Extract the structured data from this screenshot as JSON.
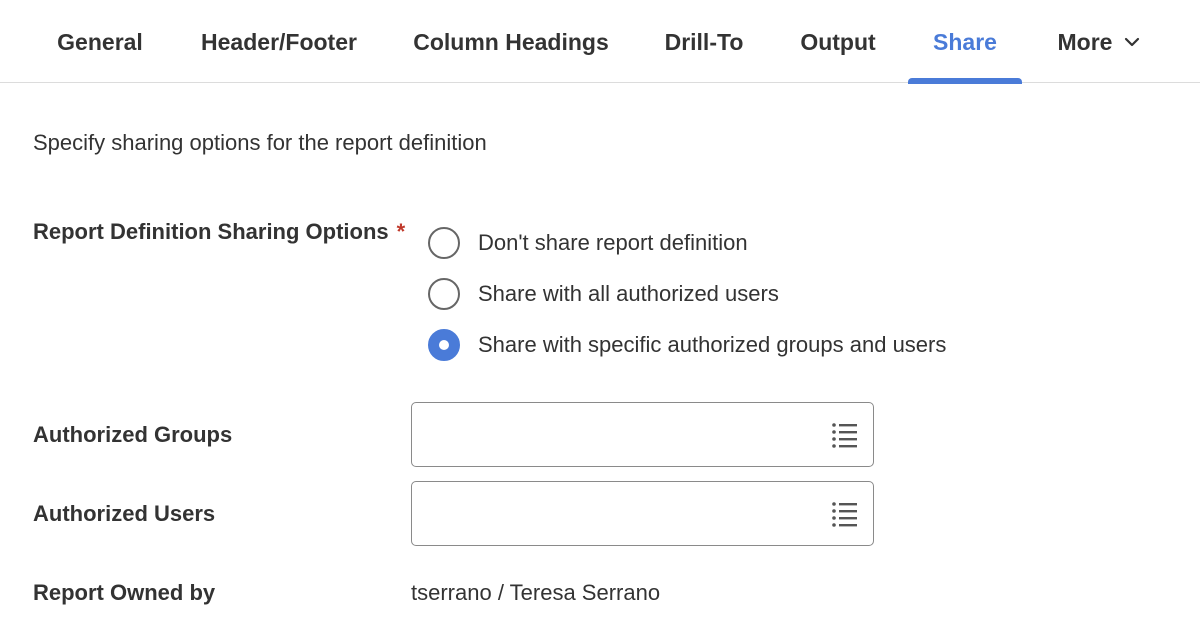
{
  "tabs": [
    {
      "label": "General"
    },
    {
      "label": "Header/Footer"
    },
    {
      "label": "Column Headings"
    },
    {
      "label": "Drill-To"
    },
    {
      "label": "Output"
    },
    {
      "label": "Share",
      "active": true
    },
    {
      "label": "More"
    }
  ],
  "intro": "Specify sharing options for the report definition",
  "sharing": {
    "label": "Report Definition Sharing Options",
    "required_marker": "*",
    "options": [
      {
        "label": "Don't share report definition",
        "selected": false
      },
      {
        "label": "Share with all authorized users",
        "selected": false
      },
      {
        "label": "Share with specific authorized groups and users",
        "selected": true
      }
    ]
  },
  "groups": {
    "label": "Authorized Groups",
    "value": "",
    "icon": "list-icon"
  },
  "users": {
    "label": "Authorized Users",
    "value": "",
    "icon": "list-icon"
  },
  "owner": {
    "label": "Report Owned by",
    "value": "tserrano / Teresa Serrano"
  },
  "colors": {
    "accent": "#4a7bd8",
    "required": "#c0392b",
    "text": "#333333"
  }
}
